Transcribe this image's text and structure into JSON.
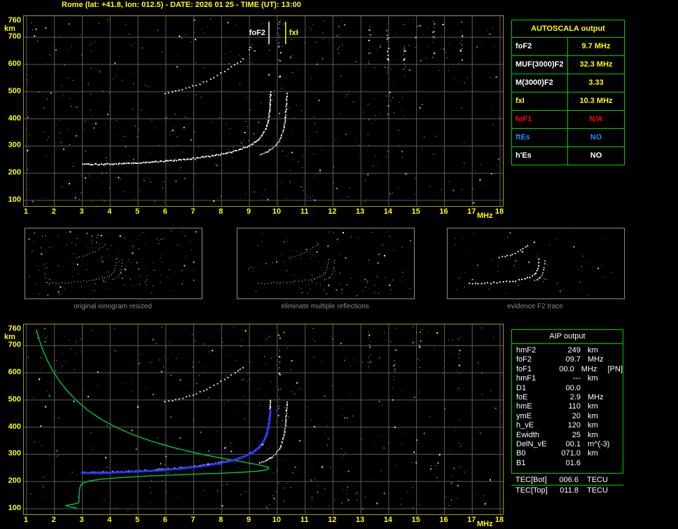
{
  "title": "Rome (lat: +41.8, lon: 012.5) - DATE: 2026 01 25 - TIME (UT): 13:00",
  "colors": {
    "background": "#000000",
    "accent_yellow": "#ffff00",
    "plot_border": "#9e9e00",
    "grid": "#5c5c5c",
    "trace_white": "#ffffff",
    "profile_green": "#00bb33",
    "fitted_blue": "#2233ff",
    "table_green": "#00cc00",
    "alert_red": "#ff0000",
    "info_blue": "#1a8cff",
    "caption_gray": "#8a8a8a"
  },
  "autoscala_table": {
    "title": "AUTOSCALA output",
    "rows": [
      {
        "label": "foF2",
        "value": "9.7 MHz",
        "label_color": "#ffffff",
        "value_color": "#ffff00"
      },
      {
        "label": "MUF(3000)F2",
        "value": "32.3 MHz",
        "label_color": "#ffffff",
        "value_color": "#ffff00"
      },
      {
        "label": "M(3000)F2",
        "value": "3.33",
        "label_color": "#ffffff",
        "value_color": "#ffff00"
      },
      {
        "label": "fxI",
        "value": "10.3 MHz",
        "label_color": "#ffff00",
        "value_color": "#ffff00"
      },
      {
        "label": "foF1",
        "value": "N/A",
        "label_color": "#ff0000",
        "value_color": "#ff0000"
      },
      {
        "label": "ftEs",
        "value": "NO",
        "label_color": "#1a8cff",
        "value_color": "#1a8cff"
      },
      {
        "label": "h'Es",
        "value": "NO",
        "label_color": "#ffffff",
        "value_color": "#ffffff"
      }
    ]
  },
  "panels": [
    {
      "caption": "original ionogram resized"
    },
    {
      "caption": "eliminate multiple reflections"
    },
    {
      "caption": "evidence F2 trace"
    }
  ],
  "aip_table": {
    "title": "AIP output",
    "rows": [
      {
        "name": "hmF2",
        "value": "249",
        "unit": "km",
        "extra": ""
      },
      {
        "name": "foF2",
        "value": "09.7",
        "unit": "MHz",
        "extra": ""
      },
      {
        "name": "foF1",
        "value": "00.0",
        "unit": "MHz",
        "extra": "[PN]"
      },
      {
        "name": "hmF1",
        "value": "---",
        "unit": "km",
        "extra": ""
      },
      {
        "name": "D1",
        "value": "00.0",
        "unit": "",
        "extra": ""
      },
      {
        "name": "foE",
        "value": "2.9",
        "unit": "MHz",
        "extra": ""
      },
      {
        "name": "hmE",
        "value": "110",
        "unit": "km",
        "extra": ""
      },
      {
        "name": "ymE",
        "value": "20",
        "unit": "km",
        "extra": ""
      },
      {
        "name": "h_vE",
        "value": "120",
        "unit": "km",
        "extra": ""
      },
      {
        "name": "Ewidth",
        "value": "25",
        "unit": "km",
        "extra": ""
      },
      {
        "name": "DelN_vE",
        "value": "00.1",
        "unit": "m^(-3)",
        "extra": ""
      },
      {
        "name": "B0",
        "value": "071.0",
        "unit": "km",
        "extra": ""
      },
      {
        "name": "B1",
        "value": "01.6",
        "unit": "",
        "extra": ""
      }
    ],
    "tec_rows": [
      {
        "name": "TEC[Bot]",
        "value": "006.6",
        "unit": "TECU"
      },
      {
        "name": "TEC[Top]",
        "value": "011.8",
        "unit": "TECU"
      }
    ]
  },
  "chart_data": {
    "type": "scatter",
    "title": "Rome ionogram 2026-01-25 13:00 UT with AUTOSCALA interpretation",
    "x_axis": {
      "label": "MHz",
      "min": 1,
      "max": 18,
      "ticks": [
        1,
        2,
        3,
        4,
        5,
        6,
        7,
        8,
        9,
        10,
        11,
        12,
        13,
        14,
        15,
        16,
        17,
        18
      ]
    },
    "y_axis": {
      "label": "km",
      "min": 100,
      "max": 760,
      "ticks": [
        760,
        700,
        600,
        500,
        400,
        300,
        200,
        100
      ]
    },
    "grid": true,
    "markers": [
      {
        "label": "foF2",
        "mhz": 9.7,
        "color": "#ffffff"
      },
      {
        "label": "fxI",
        "mhz": 10.3,
        "color": "#ffff00"
      }
    ],
    "series": {
      "f2_trace": {
        "name": "F2 ordinary trace (echo, white)",
        "color": "#ffffff",
        "points": [
          [
            3.0,
            236
          ],
          [
            3.3,
            235
          ],
          [
            3.6,
            235
          ],
          [
            3.9,
            236
          ],
          [
            4.2,
            237
          ],
          [
            4.5,
            238
          ],
          [
            4.8,
            240
          ],
          [
            5.1,
            241
          ],
          [
            5.4,
            243
          ],
          [
            5.7,
            245
          ],
          [
            6.0,
            247
          ],
          [
            6.3,
            250
          ],
          [
            6.6,
            253
          ],
          [
            6.9,
            256
          ],
          [
            7.2,
            260
          ],
          [
            7.5,
            264
          ],
          [
            7.8,
            269
          ],
          [
            8.1,
            275
          ],
          [
            8.4,
            282
          ],
          [
            8.65,
            290
          ],
          [
            8.9,
            300
          ],
          [
            9.1,
            311
          ],
          [
            9.3,
            325
          ],
          [
            9.45,
            342
          ],
          [
            9.55,
            362
          ],
          [
            9.63,
            386
          ],
          [
            9.68,
            414
          ],
          [
            9.71,
            444
          ],
          [
            9.73,
            476
          ],
          [
            9.74,
            505
          ]
        ]
      },
      "x_trace": {
        "name": "F2 extraordinary trace (white)",
        "color": "#ffffff",
        "points": [
          [
            9.35,
            270
          ],
          [
            9.55,
            278
          ],
          [
            9.75,
            289
          ],
          [
            9.92,
            303
          ],
          [
            10.05,
            321
          ],
          [
            10.14,
            343
          ],
          [
            10.21,
            369
          ],
          [
            10.26,
            399
          ],
          [
            10.29,
            433
          ],
          [
            10.31,
            468
          ],
          [
            10.32,
            500
          ]
        ]
      },
      "second_hop": {
        "name": "second-hop multiple reflection",
        "color": "#ffffff",
        "points": [
          [
            5.95,
            496
          ],
          [
            6.2,
            501
          ],
          [
            6.45,
            507
          ],
          [
            6.7,
            514
          ],
          [
            6.95,
            522
          ],
          [
            7.2,
            531
          ],
          [
            7.45,
            542
          ],
          [
            7.7,
            555
          ],
          [
            7.95,
            570
          ],
          [
            8.2,
            586
          ],
          [
            8.45,
            602
          ],
          [
            8.65,
            615
          ],
          [
            8.85,
            628
          ]
        ]
      },
      "profile": {
        "name": "electron density profile (green)",
        "color": "#00bb33",
        "points": [
          [
            1.35,
            760
          ],
          [
            1.45,
            722
          ],
          [
            1.58,
            684
          ],
          [
            1.74,
            646
          ],
          [
            1.94,
            608
          ],
          [
            2.18,
            570
          ],
          [
            2.46,
            533
          ],
          [
            2.8,
            497
          ],
          [
            3.2,
            462
          ],
          [
            3.66,
            430
          ],
          [
            4.2,
            400
          ],
          [
            4.82,
            372
          ],
          [
            5.52,
            347
          ],
          [
            6.3,
            324
          ],
          [
            7.12,
            304
          ],
          [
            7.95,
            287
          ],
          [
            8.72,
            273
          ],
          [
            9.3,
            262
          ],
          [
            9.62,
            254
          ],
          [
            9.7,
            249
          ],
          [
            9.62,
            243
          ],
          [
            9.3,
            238
          ],
          [
            8.7,
            234
          ],
          [
            7.9,
            230
          ],
          [
            7.0,
            227
          ],
          [
            6.05,
            223
          ],
          [
            5.15,
            219
          ],
          [
            4.35,
            214
          ],
          [
            3.7,
            209
          ],
          [
            3.25,
            202
          ],
          [
            3.0,
            193
          ],
          [
            2.92,
            181
          ],
          [
            2.9,
            168
          ],
          [
            2.89,
            154
          ],
          [
            2.88,
            140
          ],
          [
            2.88,
            128
          ],
          [
            2.85,
            121
          ],
          [
            2.7,
            117
          ],
          [
            2.52,
            114
          ],
          [
            2.4,
            111
          ],
          [
            2.55,
            107
          ],
          [
            2.75,
            103
          ],
          [
            2.82,
            100
          ]
        ]
      },
      "fitted_trace": {
        "name": "AUTOSCALA fitted F2 trace (blue)",
        "color": "#2233ff",
        "points": [
          [
            2.95,
            236
          ],
          [
            3.4,
            235
          ],
          [
            3.9,
            236
          ],
          [
            4.4,
            238
          ],
          [
            4.9,
            240
          ],
          [
            5.4,
            243
          ],
          [
            5.9,
            246
          ],
          [
            6.4,
            250
          ],
          [
            6.9,
            256
          ],
          [
            7.4,
            262
          ],
          [
            7.9,
            271
          ],
          [
            8.35,
            281
          ],
          [
            8.75,
            294
          ],
          [
            9.05,
            309
          ],
          [
            9.28,
            327
          ],
          [
            9.45,
            349
          ],
          [
            9.57,
            376
          ],
          [
            9.65,
            406
          ],
          [
            9.7,
            440
          ],
          [
            9.72,
            474
          ]
        ]
      }
    }
  }
}
